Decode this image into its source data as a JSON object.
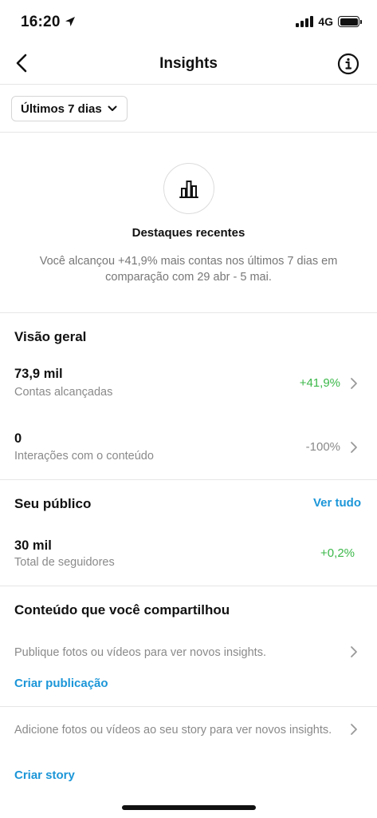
{
  "status_bar": {
    "time": "16:20",
    "network": "4G"
  },
  "nav": {
    "title": "Insights"
  },
  "filter": {
    "label": "Últimos 7 dias"
  },
  "highlight": {
    "title": "Destaques recentes",
    "text": "Você alcançou +41,9% mais contas nos últimos 7 dias em comparação com 29 abr - 5 mai."
  },
  "overview": {
    "title": "Visão geral",
    "metrics": [
      {
        "value": "73,9 mil",
        "label": "Contas alcançadas",
        "change": "+41,9%"
      },
      {
        "value": "0",
        "label": "Interações com o conteúdo",
        "change": "-100%"
      }
    ]
  },
  "audience": {
    "title": "Seu público",
    "see_all": "Ver tudo",
    "metric": {
      "value": "30 mil",
      "label": "Total de seguidores",
      "change": "+0,2%"
    }
  },
  "content": {
    "title": "Conteúdo que você compartilhou",
    "posts_text": "Publique fotos ou vídeos para ver novos insights.",
    "create_post": "Criar publicação",
    "story_text": "Adicione fotos ou vídeos ao seu story para ver novos insights.",
    "create_story": "Criar story"
  },
  "colors": {
    "positive": "#3cb84a",
    "link": "#1c96d8",
    "muted": "#8a8a8a"
  },
  "icons": [
    "location-arrow-icon",
    "signal-icon",
    "battery-icon",
    "back-arrow-icon",
    "info-icon",
    "chevron-down-icon",
    "bar-chart-icon",
    "chevron-right-icon"
  ]
}
